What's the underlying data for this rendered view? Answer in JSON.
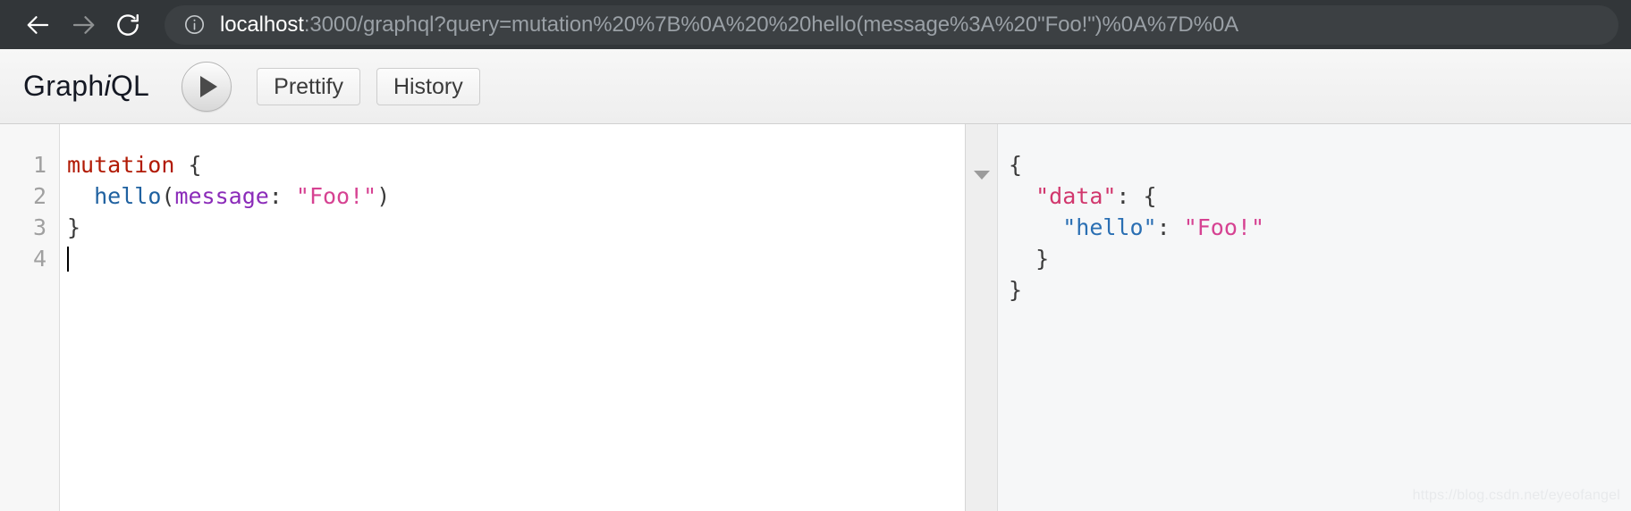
{
  "browser": {
    "back_icon": "arrow-left-icon",
    "forward_icon": "arrow-right-icon",
    "reload_icon": "reload-icon",
    "site_info_icon": "info-circle-icon",
    "url_host": "localhost",
    "url_rest": ":3000/graphql?query=mutation%20%7B%0A%20%20hello(message%3A%20\"Foo!\")%0A%7D%0A",
    "url_full": "localhost:3000/graphql?query=mutation%20%7B%0A%20%20hello(message%3A%20\"Foo!\")%0A%7D%0A",
    "chrome_bg": "#323639",
    "omnibox_bg": "#3c4043"
  },
  "toolbar": {
    "logo_prefix": "Graph",
    "logo_italic": "i",
    "logo_suffix": "QL",
    "execute_icon": "play-icon",
    "execute_label": "Execute Query",
    "prettify_label": "Prettify",
    "history_label": "History"
  },
  "editor": {
    "line_numbers": [
      "1",
      "2",
      "3",
      "4"
    ],
    "lines": [
      {
        "keyword": "mutation",
        "space": " ",
        "brace": "{"
      },
      {
        "indent": "  ",
        "field": "hello",
        "open_paren": "(",
        "arg": "message",
        "colon": ": ",
        "string": "\"Foo!\"",
        "close_paren": ")"
      },
      {
        "brace": "}"
      },
      {
        "empty": ""
      }
    ],
    "colors": {
      "keyword": "#b11a04",
      "field": "#1f61a0",
      "argument": "#8b2bb9",
      "string": "#d64292",
      "punctuation": "#3b3b3b"
    }
  },
  "result": {
    "fold_icon": "chevron-down-fold-icon",
    "lines": [
      {
        "text": "{"
      },
      {
        "indent": "  ",
        "key": "\"data\"",
        "rest": ": {"
      },
      {
        "indent": "    ",
        "key": "\"hello\"",
        "sep": ": ",
        "value": "\"Foo!\""
      },
      {
        "indent": "  ",
        "text": "}"
      },
      {
        "text": "}"
      }
    ],
    "colors": {
      "key_data": "#d1376d",
      "key_hello": "#2a6fb3",
      "string": "#d64292",
      "punctuation": "#3b3b3b"
    }
  },
  "watermark": {
    "text": "https://blog.csdn.net/eyeofangel"
  }
}
